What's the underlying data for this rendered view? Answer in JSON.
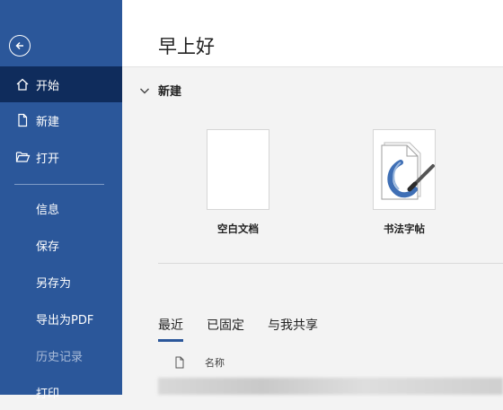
{
  "sidebar": {
    "items": [
      {
        "label": "开始"
      },
      {
        "label": "新建"
      },
      {
        "label": "打开"
      },
      {
        "label": "信息"
      },
      {
        "label": "保存"
      },
      {
        "label": "另存为"
      },
      {
        "label": "导出为PDF"
      },
      {
        "label": "历史记录"
      },
      {
        "label": "打印"
      }
    ]
  },
  "header": {
    "greeting": "早上好"
  },
  "new_section": {
    "title": "新建",
    "templates": [
      {
        "label": "空白文档",
        "icon": "blank-document-icon"
      },
      {
        "label": "书法字帖",
        "icon": "calligraphy-icon"
      }
    ]
  },
  "recent": {
    "tabs": [
      {
        "label": "最近"
      },
      {
        "label": "已固定"
      },
      {
        "label": "与我共享"
      }
    ],
    "column_name": "名称"
  },
  "colors": {
    "sidebar": "#2b579a",
    "active": "#0f2c5c",
    "background": "#f3f3f3"
  }
}
